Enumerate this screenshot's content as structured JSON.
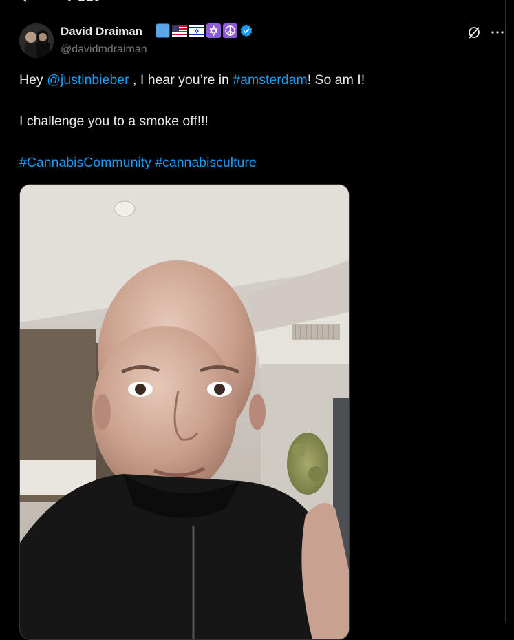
{
  "header": {
    "title": "Post"
  },
  "author": {
    "display_name": "David Draiman",
    "handle": "@davidmdraiman",
    "badges": [
      "blue-square",
      "us-flag",
      "israel-flag",
      "star-of-david",
      "peace-symbol",
      "verified-badge"
    ]
  },
  "post": {
    "greeting": "Hey ",
    "mention": "@justinbieber",
    "text_mid": " , I hear you’re in ",
    "hashtag_location": "#amsterdam",
    "text_end": "! So am I!",
    "line2": "I challenge you to a smoke off!!!",
    "hashtag1": "#CannabisCommunity",
    "hashtag_separator": " ",
    "hashtag2": "#cannabisculture"
  },
  "colors": {
    "background": "#000000",
    "text": "#e7e9ea",
    "secondary": "#71767b",
    "link": "#1d9bf0",
    "verified": "#1d9bf0",
    "border": "#2f3336"
  }
}
